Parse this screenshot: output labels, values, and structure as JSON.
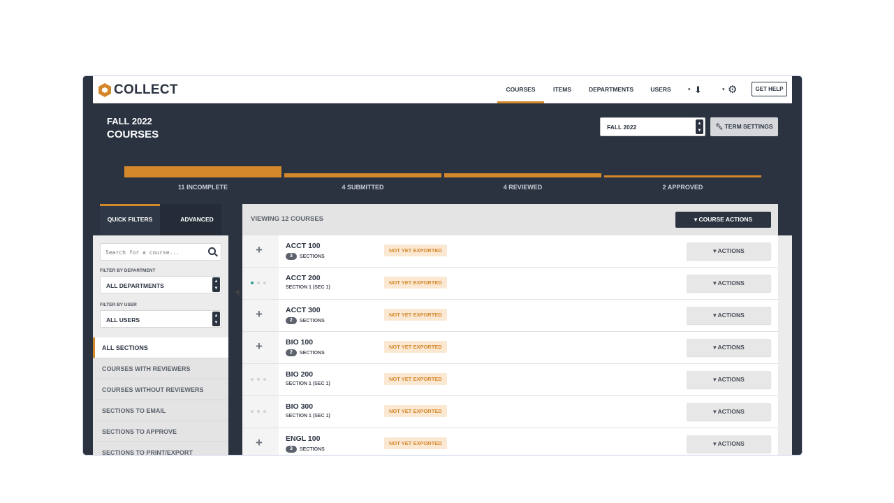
{
  "app": {
    "logo_text": "COLLECT"
  },
  "nav": {
    "items": [
      "COURSES",
      "ITEMS",
      "DEPARTMENTS",
      "USERS"
    ],
    "active": "COURSES",
    "download_icon": "download-icon",
    "settings_icon": "gear-icon",
    "help_label": "GET HELP"
  },
  "header": {
    "term": "FALL 2022",
    "title": "COURSES",
    "term_select": "FALL 2022",
    "term_settings_label": "TERM SETTINGS"
  },
  "progress": [
    {
      "label": "11 INCOMPLETE",
      "count": 11
    },
    {
      "label": "4 SUBMITTED",
      "count": 4
    },
    {
      "label": "4 REVIEWED",
      "count": 4
    },
    {
      "label": "2 APPROVED",
      "count": 2
    }
  ],
  "filters_panel": {
    "tabs": [
      "QUICK FILTERS",
      "ADVANCED"
    ],
    "search_placeholder": "Search for a course...",
    "department_label": "FILTER BY DEPARTMENT",
    "department_value": "ALL DEPARTMENTS",
    "user_label": "FILTER BY USER",
    "user_value": "ALL USERS",
    "quick_filters": [
      "ALL SECTIONS",
      "COURSES WITH REVIEWERS",
      "COURSES WITHOUT REVIEWERS",
      "SECTIONS TO EMAIL",
      "SECTIONS TO APPROVE",
      "SECTIONS TO PRINT/EXPORT"
    ]
  },
  "list": {
    "viewing_label": "VIEWING 12 COURSES",
    "course_actions_label": "COURSE ACTIONS",
    "rows": [
      {
        "name": "ACCT 100",
        "count": "3",
        "sub": "SECTIONS",
        "status": "NOT YET EXPORTED",
        "action": "ACTIONS",
        "lead": "plus"
      },
      {
        "name": "ACCT 200",
        "count": "",
        "sub": "SECTION 1 (SEC 1)",
        "status": "NOT YET EXPORTED",
        "action": "ACTIONS",
        "lead": "dots-active"
      },
      {
        "name": "ACCT 300",
        "count": "2",
        "sub": "SECTIONS",
        "status": "NOT YET EXPORTED",
        "action": "ACTIONS",
        "lead": "plus"
      },
      {
        "name": "BIO 100",
        "count": "2",
        "sub": "SECTIONS",
        "status": "NOT YET EXPORTED",
        "action": "ACTIONS",
        "lead": "plus"
      },
      {
        "name": "BIO 200",
        "count": "",
        "sub": "SECTION 1 (SEC 1)",
        "status": "NOT YET EXPORTED",
        "action": "ACTIONS",
        "lead": "dots"
      },
      {
        "name": "BIO 300",
        "count": "",
        "sub": "SECTION 1 (SEC 1)",
        "status": "NOT YET EXPORTED",
        "action": "ACTIONS",
        "lead": "dots"
      },
      {
        "name": "ENGL 100",
        "count": "3",
        "sub": "SECTIONS",
        "status": "NOT YET EXPORTED",
        "action": "ACTIONS",
        "lead": "plus"
      }
    ]
  },
  "colors": {
    "accent": "#d4882c",
    "dark": "#2b3341",
    "badge_bg": "#fbe8d2",
    "dot_active": "#2a9d8f"
  }
}
